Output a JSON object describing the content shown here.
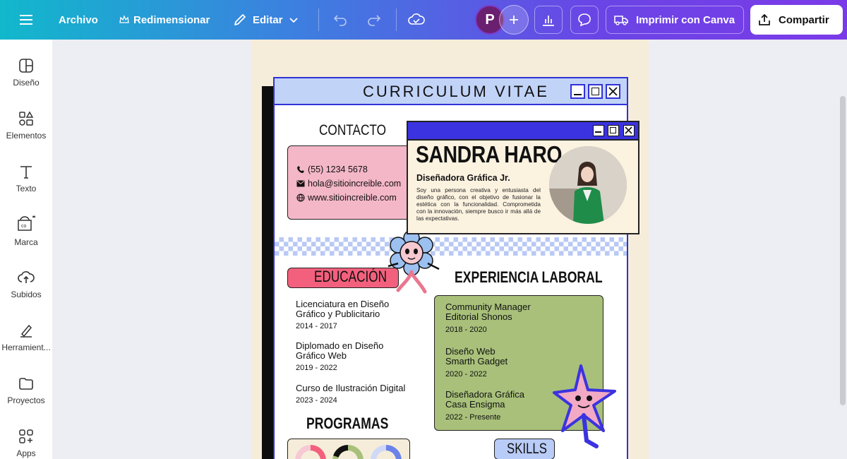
{
  "topbar": {
    "menu_label": "Archivo",
    "resize_label": "Redimensionar",
    "edit_label": "Editar",
    "avatar_letter": "P",
    "print_label": "Imprimir con Canva",
    "share_label": "Compartir"
  },
  "sidebar": {
    "items": [
      {
        "label": "Diseño",
        "icon": "design-icon"
      },
      {
        "label": "Elementos",
        "icon": "elements-icon"
      },
      {
        "label": "Texto",
        "icon": "text-icon"
      },
      {
        "label": "Marca",
        "icon": "brand-icon"
      },
      {
        "label": "Subidos",
        "icon": "upload-icon"
      },
      {
        "label": "Herramient...",
        "icon": "tools-icon"
      },
      {
        "label": "Proyectos",
        "icon": "folder-icon"
      },
      {
        "label": "Apps",
        "icon": "apps-icon"
      }
    ]
  },
  "resume": {
    "window_title": "CURRICULUM VITAE",
    "contact_heading": "CONTACTO",
    "phone": "(55) 1234 5678",
    "email": "hola@sitioincreible.com",
    "website": "www.sitioincreible.com",
    "name": "SANDRA HARO",
    "role": "Diseñadora Gráfica Jr.",
    "about": "Soy una persona creativa y entusiasta del diseño gráfico, con el objetivo de fusionar la estética con la funcionalidad. Comprometida con la innovación, siempre busco ir más allá de las expectativas.",
    "education_heading": "EDUCACIÓN",
    "experience_heading": "EXPERIENCIA LABORAL",
    "education": [
      {
        "name": "Licenciatura en Diseño Gráfico y Publicitario",
        "years": "2014 - 2017"
      },
      {
        "name": "Diplomado en Diseño Gráfico Web",
        "years": "2019 - 2022"
      },
      {
        "name": "Curso de Ilustración Digital",
        "years": "2023 - 2024"
      }
    ],
    "experience": [
      {
        "name": "Community Manager Editorial Shonos",
        "years": "2018 - 2020"
      },
      {
        "name": "Diseño Web Smarth Gadget",
        "years": "2020 - 2022"
      },
      {
        "name": "Diseñadora Gráfica Casa Ensigma",
        "years": "2022 - Presente"
      }
    ],
    "programs_heading": "PROGRAMAS",
    "skills_heading": "SKILLS"
  },
  "colors": {
    "window_border": "#3131d8",
    "title_bar": "#c1d3f7",
    "contact_box": "#f4b7c8",
    "education_pill": "#f3607d",
    "experience_box": "#a8c07a",
    "page_bg": "#f5edd9"
  }
}
